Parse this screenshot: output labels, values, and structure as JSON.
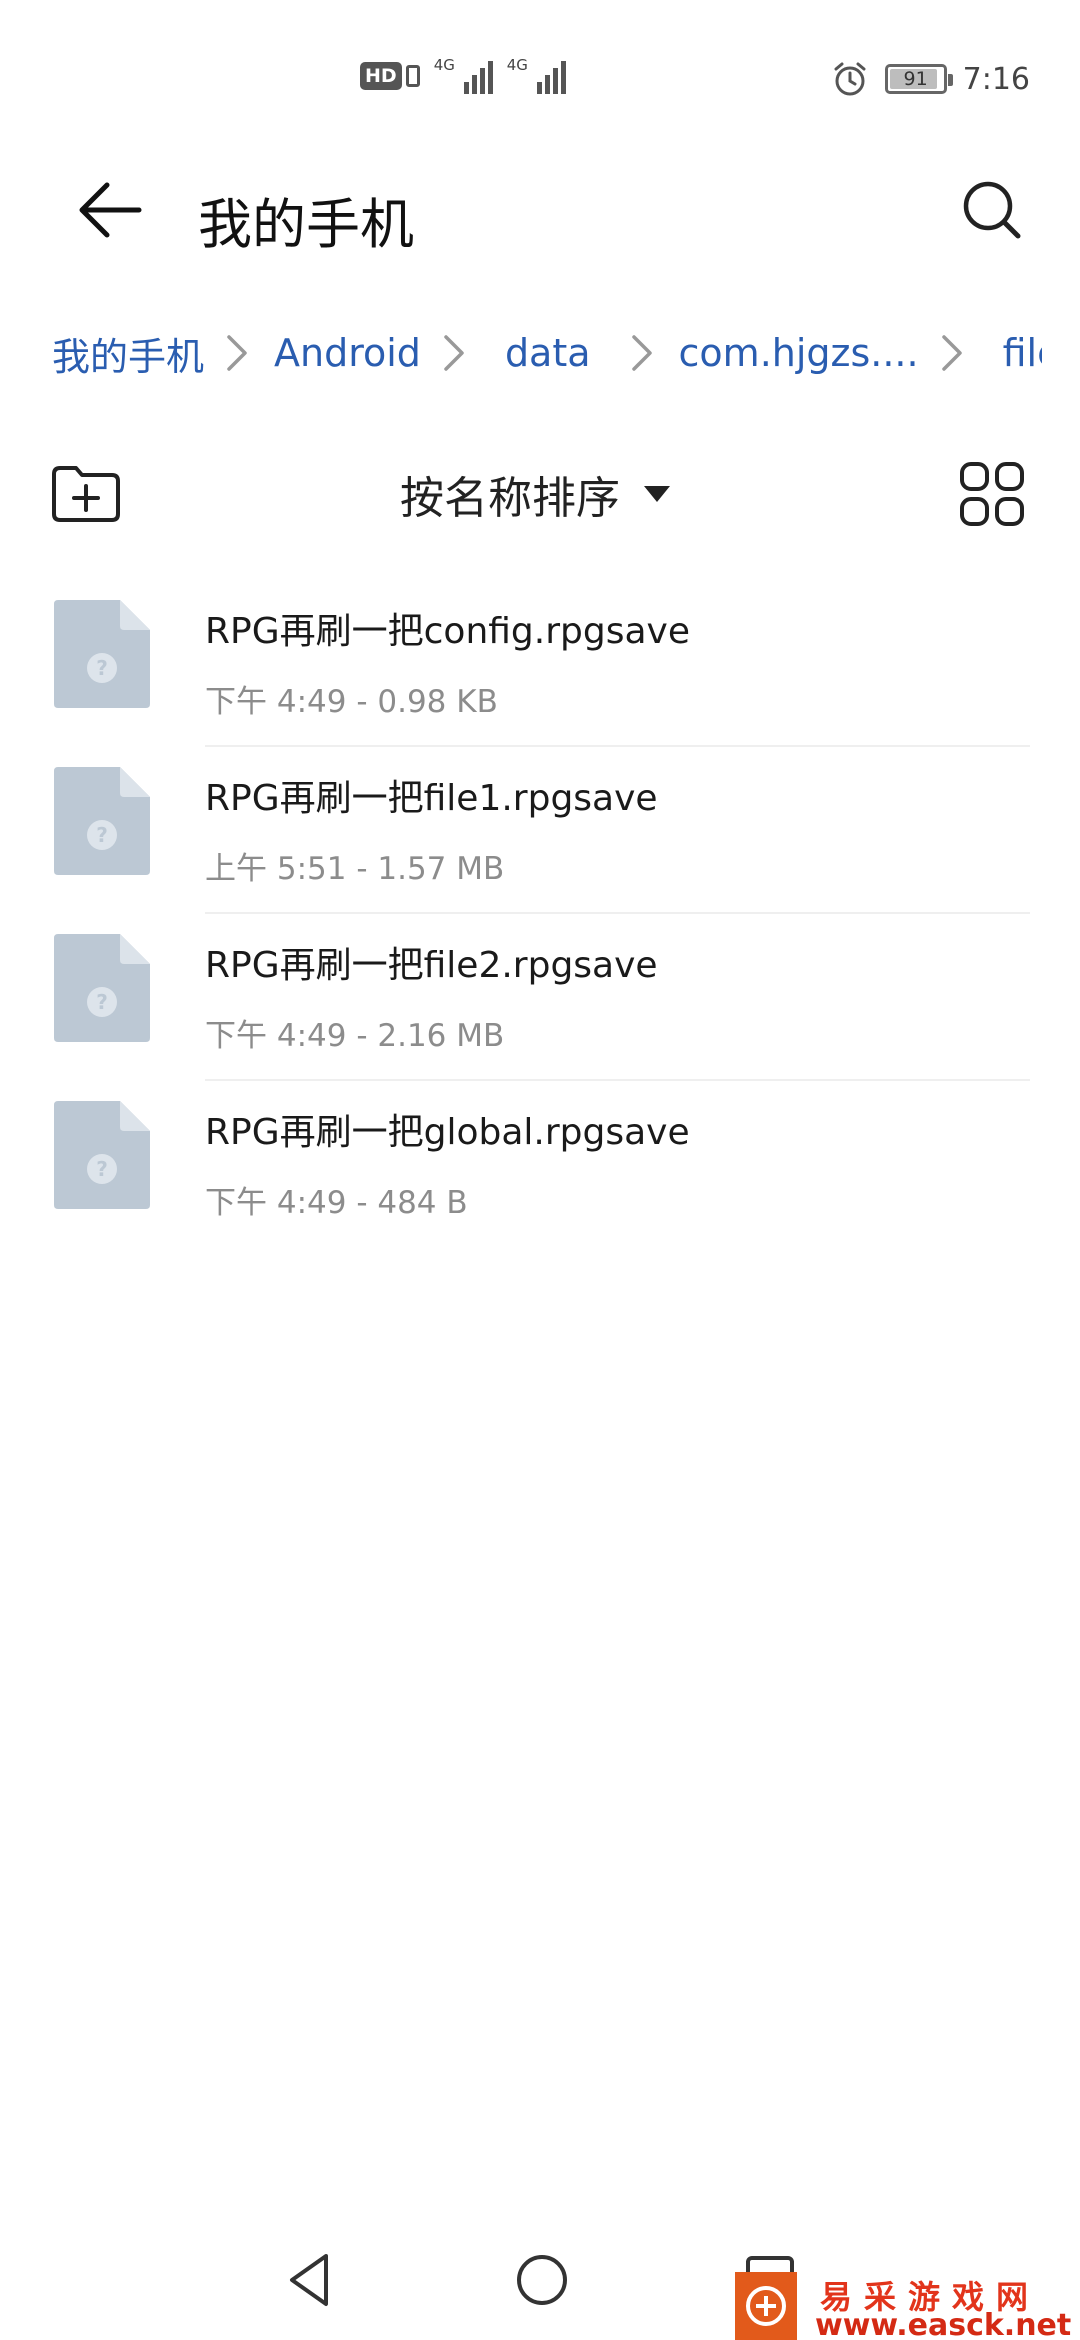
{
  "status_bar": {
    "hd_label": "HD",
    "network_1": "4G",
    "network_2": "4G",
    "battery_level": 91,
    "battery_label": "91",
    "time": "7:16",
    "icons": [
      "hd-icon",
      "signal-icon",
      "alarm-icon",
      "battery-icon"
    ]
  },
  "app_bar": {
    "title": "我的手机",
    "icons": {
      "back": "arrow-left-icon",
      "search": "search-icon"
    }
  },
  "breadcrumb": {
    "items": [
      "我的手机",
      "Android",
      "data",
      "com.hjgzs....",
      "files"
    ]
  },
  "toolbar": {
    "sort_label": "按名称排序",
    "icons": {
      "new_folder": "folder-add-icon",
      "sort": "caret-down-icon",
      "view": "grid-view-icon"
    }
  },
  "files": [
    {
      "name": "RPG再刷一把config.rpgsave",
      "meta": "下午 4:49  - 0.98 KB"
    },
    {
      "name": "RPG再刷一把file1.rpgsave",
      "meta": "上午 5:51  - 1.57 MB"
    },
    {
      "name": "RPG再刷一把file2.rpgsave",
      "meta": "下午 4:49  - 2.16 MB"
    },
    {
      "name": "RPG再刷一把global.rpgsave",
      "meta": "下午 4:49  - 484 B"
    }
  ],
  "nav_bar": {
    "icons": [
      "nav-back-icon",
      "nav-home-icon",
      "nav-recent-icon"
    ]
  },
  "watermark": {
    "name": "易采游戏网",
    "url": "www.easck.net"
  },
  "colors": {
    "accent": "#2a5db0",
    "file_icon": "#bcc8d4",
    "meta_text": "#8c8c8c",
    "watermark": "#e25a1b"
  }
}
